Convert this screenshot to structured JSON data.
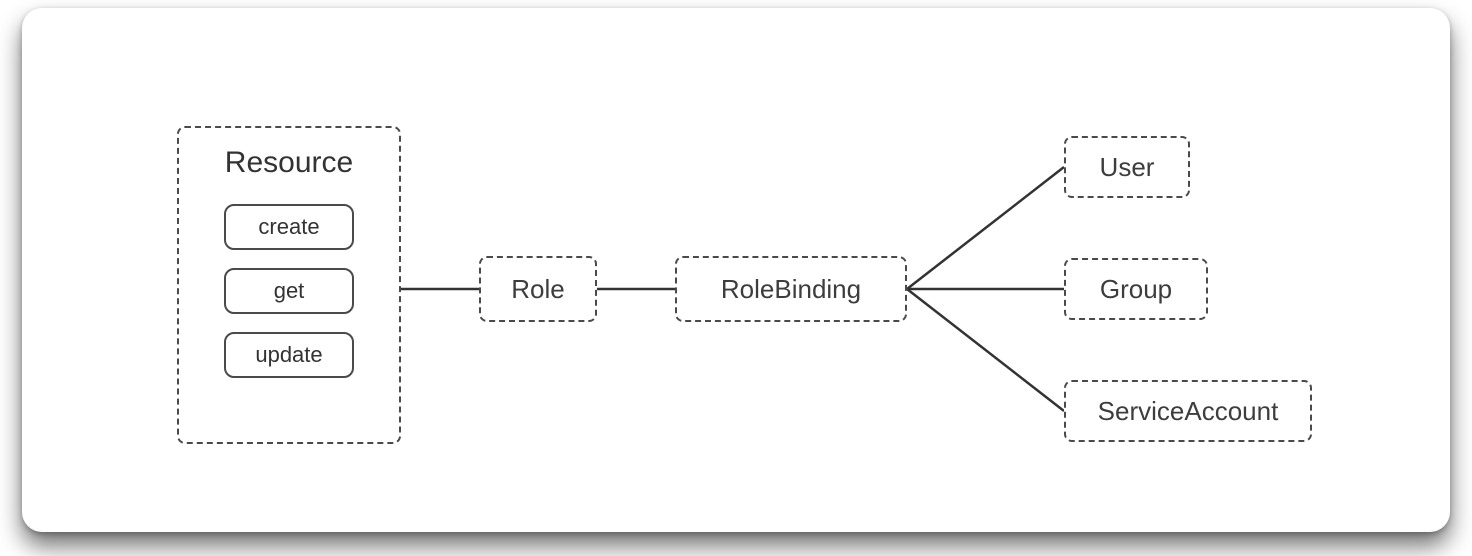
{
  "resource": {
    "title": "Resource",
    "verbs": [
      "create",
      "get",
      "update"
    ]
  },
  "role": {
    "label": "Role"
  },
  "rolebinding": {
    "label": "RoleBinding"
  },
  "subjects": {
    "user": "User",
    "group": "Group",
    "serviceAccount": "ServiceAccount"
  }
}
